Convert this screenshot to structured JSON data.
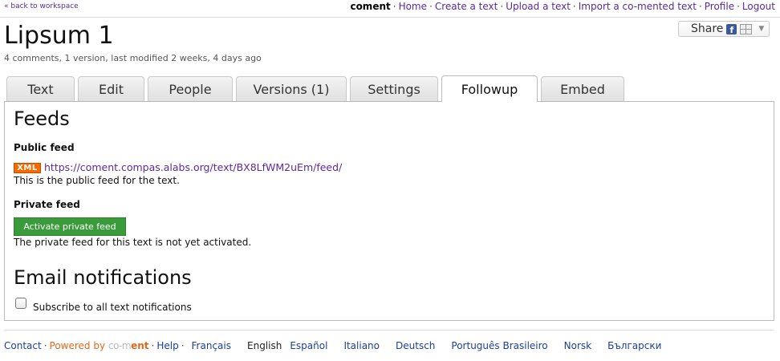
{
  "header": {
    "back_link": "« back to workspace",
    "brand": "coment",
    "nav": [
      "Home",
      "Create a text",
      "Upload a text",
      "Import a co-mented text",
      "Profile",
      "Logout"
    ],
    "nav_separator": "·"
  },
  "document": {
    "title": "Lipsum 1",
    "meta": "4 comments, 1 version, last modified 2 weeks, 4 days ago"
  },
  "share": {
    "label": "Share",
    "icons": [
      "facebook-icon",
      "multi-share-icon",
      "caret-down-icon"
    ],
    "facebook_glyph": "f",
    "caret_glyph": "▼"
  },
  "tabs": [
    {
      "label": "Text",
      "active": false
    },
    {
      "label": "Edit",
      "active": false
    },
    {
      "label": "People",
      "active": false
    },
    {
      "label": "Versions (1)",
      "active": false
    },
    {
      "label": "Settings",
      "active": false
    },
    {
      "label": "Followup",
      "active": true
    },
    {
      "label": "Embed",
      "active": false
    }
  ],
  "feeds": {
    "heading": "Feeds",
    "public_heading": "Public feed",
    "xml_badge": "XML",
    "public_url": "https://coment.compas.alabs.org/text/BX8LfWM2uEm/feed/",
    "public_desc": "This is the public feed for the text.",
    "private_heading": "Private feed",
    "activate_button": "Activate private feed",
    "private_desc": "The private feed for this text is not yet activated."
  },
  "email": {
    "heading": "Email notifications",
    "subscribe_label": "Subscribe to all text notifications",
    "subscribed": false
  },
  "footer": {
    "contact": "Contact",
    "powered_by": "Powered by",
    "logo_co": "co-m",
    "logo_ment": "ent",
    "help": "Help",
    "languages": [
      "Français",
      "English",
      "Español",
      "Italiano",
      "Deutsch",
      "Português Brasileiro",
      "Norsk",
      "Български"
    ],
    "current_language": "English"
  },
  "colors": {
    "link": "#5a2a9c",
    "xml_badge": "#f66a00",
    "activate_button": "#3a9b3a",
    "powered_by": "#e06a1b"
  }
}
